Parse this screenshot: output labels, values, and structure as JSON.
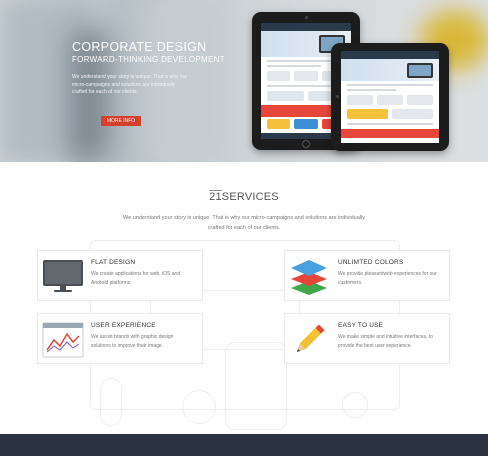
{
  "hero": {
    "title": "CORPORATE DESIGN",
    "subtitle": "FORWARD-THINKING DEVELOPMENT",
    "text": "We understand your story is unique. That is why our micro-campaigns and solutions are individually crafted for each of our clients.",
    "button_label": "MORE INFO"
  },
  "services": {
    "number": "21",
    "title_word": "SERVICES",
    "intro": "We understand your story is unique. That is why our micro-campaigns and solutions are individually crafted for each of our clients.",
    "items": [
      {
        "title": "FLAT DESIGN",
        "text": "We create applications for web, iOS and Android platforms.",
        "icon": "monitor-icon"
      },
      {
        "title": "UNLIMTED COLORS",
        "text": "We provide pleasantweb experiences for our customers.",
        "icon": "layers-icon"
      },
      {
        "title": "USER EXPERIENCE",
        "text": "We assist brands with graphic design solutions to improve their image.",
        "icon": "chart-window-icon"
      },
      {
        "title": "EASY TO USE",
        "text": "We make simple and intuitive interfaces, to provide the best user experience.",
        "icon": "pencil-icon"
      }
    ]
  },
  "colors": {
    "accent": "#d6402d",
    "footer": "#2c3340"
  }
}
